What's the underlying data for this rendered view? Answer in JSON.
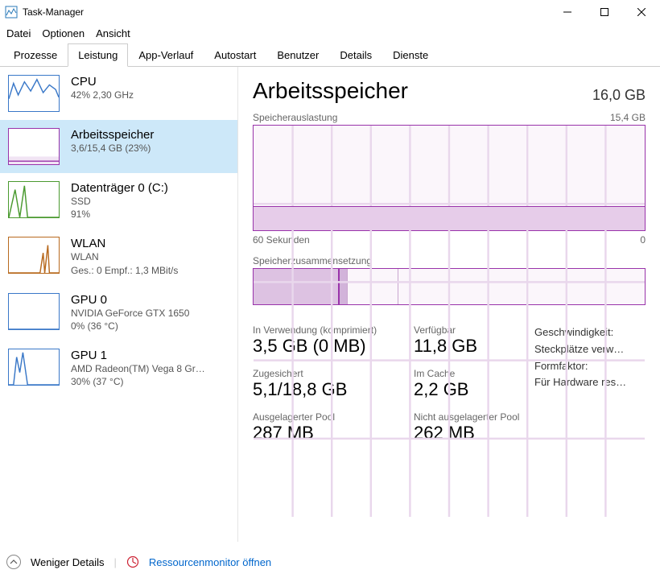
{
  "window": {
    "title": "Task-Manager",
    "menus": [
      "Datei",
      "Optionen",
      "Ansicht"
    ],
    "tabs": [
      "Prozesse",
      "Leistung",
      "App-Verlauf",
      "Autostart",
      "Benutzer",
      "Details",
      "Dienste"
    ],
    "active_tab": "Leistung"
  },
  "sidebar": {
    "items": [
      {
        "title": "CPU",
        "line2": "42%  2,30 GHz",
        "line3": "",
        "color": "#3a78c8",
        "selected": false
      },
      {
        "title": "Arbeitsspeicher",
        "line2": "3,6/15,4 GB (23%)",
        "line3": "",
        "color": "#9933aa",
        "selected": true
      },
      {
        "title": "Datenträger 0 (C:)",
        "line2": "SSD",
        "line3": "91%",
        "color": "#4a9a2f",
        "selected": false
      },
      {
        "title": "WLAN",
        "line2": "WLAN",
        "line3": "Ges.: 0  Empf.: 1,3 MBit/s",
        "color": "#b86a1f",
        "selected": false
      },
      {
        "title": "GPU 0",
        "line2": "NVIDIA GeForce GTX 1650",
        "line3": "0% (36 °C)",
        "color": "#3a78c8",
        "selected": false
      },
      {
        "title": "GPU 1",
        "line2": "AMD Radeon(TM) Vega 8 Gr…",
        "line3": "30% (37 °C)",
        "color": "#3a78c8",
        "selected": false
      }
    ]
  },
  "main": {
    "title": "Arbeitsspeicher",
    "total": "16,0 GB",
    "chart1_label_left": "Speicherauslastung",
    "chart1_label_right": "15,4 GB",
    "chart1_axis_left": "60 Sekunden",
    "chart1_axis_right": "0",
    "comp_label": "Speicherzusammensetzung",
    "stats": {
      "in_use_label": "In Verwendung (komprimiert)",
      "in_use_value": "3,5 GB (0 MB)",
      "avail_label": "Verfügbar",
      "avail_value": "11,8 GB",
      "committed_label": "Zugesichert",
      "committed_value": "5,1/18,8 GB",
      "cached_label": "Im Cache",
      "cached_value": "2,2 GB",
      "paged_label": "Ausgelagerter Pool",
      "paged_value": "287 MB",
      "nonpaged_label": "Nicht ausgelagerter Pool",
      "nonpaged_value": "262 MB"
    },
    "meta": {
      "speed_label": "Geschwindigkeit:",
      "slots_label": "Steckplätze verw…",
      "form_label": "Formfaktor:",
      "hw_label": "Für Hardware res…"
    }
  },
  "footer": {
    "less_details": "Weniger Details",
    "resmon": "Ressourcenmonitor öffnen"
  },
  "chart_data": {
    "type": "line",
    "title": "Speicherauslastung",
    "xlabel": "60 Sekunden → 0",
    "ylabel": "GB",
    "ylim": [
      0,
      15.4
    ],
    "series": [
      {
        "name": "Arbeitsspeicher",
        "values": [
          3.6,
          3.6,
          3.6,
          3.6,
          3.6,
          3.6,
          3.6,
          3.6,
          3.6,
          3.6,
          3.6,
          3.6
        ]
      }
    ]
  }
}
